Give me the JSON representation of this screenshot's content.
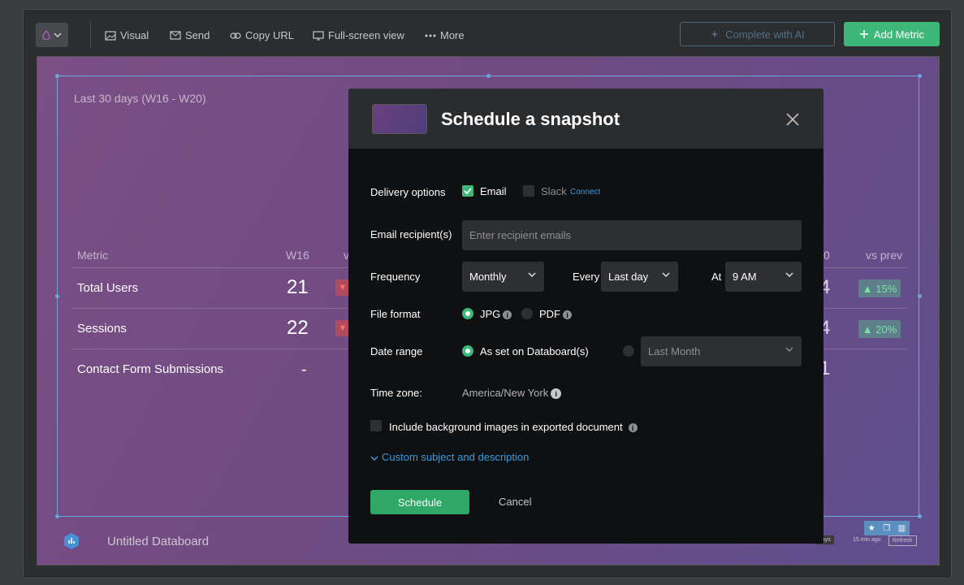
{
  "toolbar": {
    "visual": "Visual",
    "send": "Send",
    "copy_url": "Copy URL",
    "fullscreen": "Full-screen view",
    "more": "More",
    "complete_ai": "Complete with AI",
    "add_metric": "Add Metric"
  },
  "board": {
    "period": "Last 30 days (W16 - W20)",
    "headers": {
      "metric": "Metric",
      "w16": "W16",
      "vs": "v",
      "right_col": "0",
      "vs_prev": "vs prev"
    },
    "rows": [
      {
        "name": "Total Users",
        "w16": "21",
        "right": "4",
        "change": "▲ 15%"
      },
      {
        "name": "Sessions",
        "w16": "22",
        "right": "4",
        "change": "▲ 20%"
      },
      {
        "name": "Contact Form Submissions",
        "w16": "-",
        "right": "1"
      }
    ],
    "footer_title": "Untitled Databoard",
    "badge_days": "days",
    "badge_ago": "15 min ago",
    "badge_refresh": "Refresh"
  },
  "modal": {
    "title": "Schedule a snapshot",
    "delivery_label": "Delivery options",
    "email": "Email",
    "slack": "Slack",
    "connect": "Connect",
    "recipients_label": "Email recipient(s)",
    "recipients_placeholder": "Enter recipient emails",
    "frequency_label": "Frequency",
    "frequency_value": "Monthly",
    "every_label": "Every",
    "every_value": "Last day",
    "at_label": "At",
    "at_value": "9 AM",
    "format_label": "File format",
    "jpg": "JPG",
    "pdf": "PDF",
    "date_range_label": "Date range",
    "as_set": "As set on Databoard(s)",
    "last_month": "Last Month",
    "timezone_label": "Time zone:",
    "timezone_value": "America/New York",
    "include_bg": "Include background images in exported document",
    "custom_subject": "Custom subject and description",
    "schedule": "Schedule",
    "cancel": "Cancel"
  },
  "colors": {
    "accent_green": "#3db878",
    "link_blue": "#3a9be0",
    "modal_bg": "#0f1012"
  }
}
